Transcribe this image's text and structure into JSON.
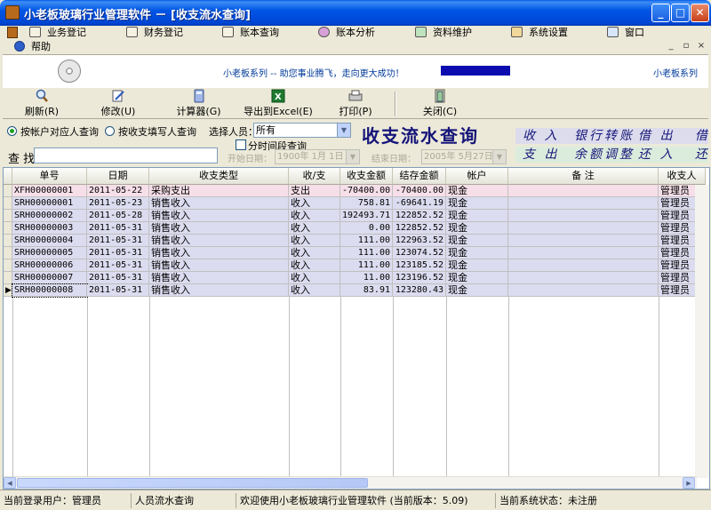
{
  "window": {
    "title": "小老板玻璃行业管理软件 － [收支流水查询]",
    "minimize": "_",
    "maximize": "□",
    "close": "✕"
  },
  "menu": {
    "items": [
      {
        "label": "业务登记",
        "icon": "pencil-icon"
      },
      {
        "label": "财务登记",
        "icon": "pencil-icon"
      },
      {
        "label": "账本查询",
        "icon": "book-icon"
      },
      {
        "label": "账本分析",
        "icon": "chart-icon"
      },
      {
        "label": "资料维护",
        "icon": "database-icon"
      },
      {
        "label": "系统设置",
        "icon": "settings-icon"
      },
      {
        "label": "窗口",
        "icon": "window-icon"
      }
    ],
    "help": "帮助",
    "mdi_min": "_",
    "mdi_restore": "▫",
    "mdi_close": "×"
  },
  "banner": {
    "marquee": "小老板系列 -- 助您事业腾飞，走向更大成功！",
    "marquee_tail": "小老板系列"
  },
  "toolbar": {
    "refresh": "刷新(R)",
    "modify": "修改(U)",
    "calculator": "计算器(G)",
    "export_excel": "导出到Excel(E)",
    "print": "打印(P)",
    "close": "关闭(C)"
  },
  "filter": {
    "radio_account": "按帐户对应人查询",
    "radio_person": "按收支填写人查询",
    "select_person_label": "选择人员：",
    "select_person_value": "所有",
    "time_range_label": "分时间段查询",
    "start_label": "开始日期：",
    "start_value": "1900年 1月 1日",
    "end_label": "结束日期：",
    "end_value": "2005年 5月27日",
    "search_label": "查  找",
    "search_value": "",
    "page_title": "收支流水查询",
    "quick_row1": [
      "收  入",
      "银行转账",
      "借 出",
      "借"
    ],
    "quick_row2": [
      "支  出",
      "余额调整",
      "还 入",
      "还"
    ]
  },
  "grid": {
    "columns": [
      "单号",
      "日期",
      "收支类型",
      "收/支",
      "收支金额",
      "结存金额",
      "帐户",
      "备  注",
      "收支人"
    ],
    "rows": [
      {
        "id": "XFH00000001",
        "date": "2011-05-22",
        "type": "采购支出",
        "io": "支出",
        "amount": "-70400.00",
        "balance": "-70400.00",
        "account": "现金",
        "note": "",
        "person": "管理员"
      },
      {
        "id": "SRH00000001",
        "date": "2011-05-23",
        "type": "销售收入",
        "io": "收入",
        "amount": "758.81",
        "balance": "-69641.19",
        "account": "现金",
        "note": "",
        "person": "管理员"
      },
      {
        "id": "SRH00000002",
        "date": "2011-05-28",
        "type": "销售收入",
        "io": "收入",
        "amount": "192493.71",
        "balance": "122852.52",
        "account": "现金",
        "note": "",
        "person": "管理员"
      },
      {
        "id": "SRH00000003",
        "date": "2011-05-31",
        "type": "销售收入",
        "io": "收入",
        "amount": "0.00",
        "balance": "122852.52",
        "account": "现金",
        "note": "",
        "person": "管理员"
      },
      {
        "id": "SRH00000004",
        "date": "2011-05-31",
        "type": "销售收入",
        "io": "收入",
        "amount": "111.00",
        "balance": "122963.52",
        "account": "现金",
        "note": "",
        "person": "管理员"
      },
      {
        "id": "SRH00000005",
        "date": "2011-05-31",
        "type": "销售收入",
        "io": "收入",
        "amount": "111.00",
        "balance": "123074.52",
        "account": "现金",
        "note": "",
        "person": "管理员"
      },
      {
        "id": "SRH00000006",
        "date": "2011-05-31",
        "type": "销售收入",
        "io": "收入",
        "amount": "111.00",
        "balance": "123185.52",
        "account": "现金",
        "note": "",
        "person": "管理员"
      },
      {
        "id": "SRH00000007",
        "date": "2011-05-31",
        "type": "销售收入",
        "io": "收入",
        "amount": "11.00",
        "balance": "123196.52",
        "account": "现金",
        "note": "",
        "person": "管理员"
      },
      {
        "id": "SRH00000008",
        "date": "2011-05-31",
        "type": "销售收入",
        "io": "收入",
        "amount": "83.91",
        "balance": "123280.43",
        "account": "现金",
        "note": "",
        "person": "管理员"
      }
    ]
  },
  "status": {
    "user": "当前登录用户：管理员",
    "window": "人员流水查询",
    "welcome": "欢迎使用小老板玻璃行业管理软件  (当前版本：5.09)",
    "sys_state": "当前系统状态：未注册"
  },
  "colors": {
    "title_blue": "#0055e5",
    "expense_row": "#f6dfe8",
    "income_row": "#dcdcf0",
    "heading_navy": "#15157a"
  }
}
